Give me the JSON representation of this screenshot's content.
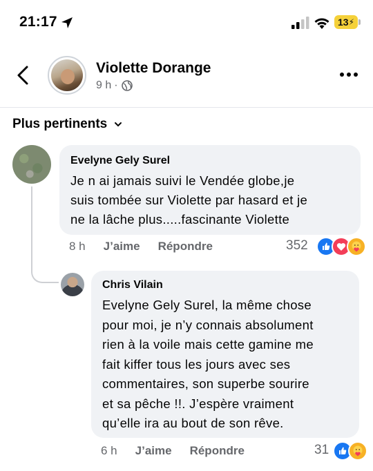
{
  "status_bar": {
    "time": "21:17",
    "battery": "13"
  },
  "header": {
    "page_name": "Violette Dorange",
    "time_ago": "9 h",
    "separator": "·"
  },
  "sort": {
    "label": "Plus pertinents"
  },
  "comments": [
    {
      "author": "Evelyne Gely Surel",
      "text": "Je n ai jamais suivi le Vendée globe,je\nsuis tombée sur Violette par hasard  et je\nne la  lâche plus.....fascinante Violette",
      "time": "8 h",
      "like_label": "J’aime",
      "reply_label": "Répondre",
      "reaction_count": "352",
      "reactions": [
        "like-icon",
        "love-icon",
        "care-icon"
      ]
    },
    {
      "author": "Chris Vilain",
      "text": "Evelyne Gely Surel, la même chose\npour moi, je n’y connais absolument\nrien à la voile mais cette gamine me\nfait kiffer tous les jours avec ses\ncommentaires, son superbe sourire\net sa pêche !!. J’espère  vraiment\nqu’elle ira au bout de son rêve.",
      "time": "6 h",
      "like_label": "J’aime",
      "reply_label": "Répondre",
      "reaction_count": "31",
      "reactions": [
        "like-icon",
        "care-icon"
      ]
    }
  ],
  "colors": {
    "link_blue": "#1877f2",
    "bubble": "#f0f2f5",
    "muted": "#65676b",
    "battery": "#f5d13a"
  }
}
